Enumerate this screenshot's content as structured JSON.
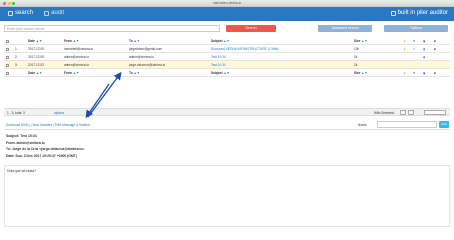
{
  "window": {
    "title": "mail-axleo.zimbra.io"
  },
  "topbar": {
    "search_label": "search",
    "audit_label": "audit",
    "user_label": "built in piler auditor"
  },
  "search": {
    "placeholder": "Enter your search terms",
    "search_button": "Search",
    "advanced_button": "Advanced search",
    "options_button": "Options"
  },
  "table": {
    "headers": {
      "date": "Date",
      "from": "From",
      "to": "To",
      "subject": "Subject",
      "size": "Size"
    },
    "rows": [
      {
        "num": "1.",
        "date": "2017.12.05",
        "from": "hsmartell@zimbra.io",
        "to": "jorgetotour@gmail.com",
        "subject": "[Success] SEGNA INFRASTRUCTURE (1 Mbit)",
        "size": "10k"
      },
      {
        "num": "2.",
        "date": "2017.12.05",
        "from": "admin@zimbra.io",
        "to": "admin@zimbra.io",
        "subject": "Test 10:34",
        "size": "2k"
      },
      {
        "num": "3.",
        "date": "2017.12.03",
        "from": "admin@zimbra.io",
        "to": "jorge.delacruz@zimbra.io",
        "subject": "Test 10:34",
        "size": "2k"
      }
    ]
  },
  "pager": {
    "info": "1 - 3, total: 3",
    "mode": "aplicha",
    "with_selected": "With Selected:"
  },
  "message": {
    "actions": "Download (EML) | View Headers | Print Message & Verified",
    "notes_label": "Notes:",
    "edit_button": "Edit",
    "subject_line": "Subject: Test 10:34",
    "from_line": "From: admin@zimbra.io",
    "to_line": "To: Jorge de la Cruz <jorge.delacruz@zimbra.io>",
    "date_line": "Date: Sun, 3 Dec 2017 19:25:37 +0000 (GMT)",
    "body": "Hola que tal estas?"
  },
  "colors": {
    "brand": "#2a78c3",
    "danger": "#e9574d",
    "accent": "#3fb6e3"
  }
}
